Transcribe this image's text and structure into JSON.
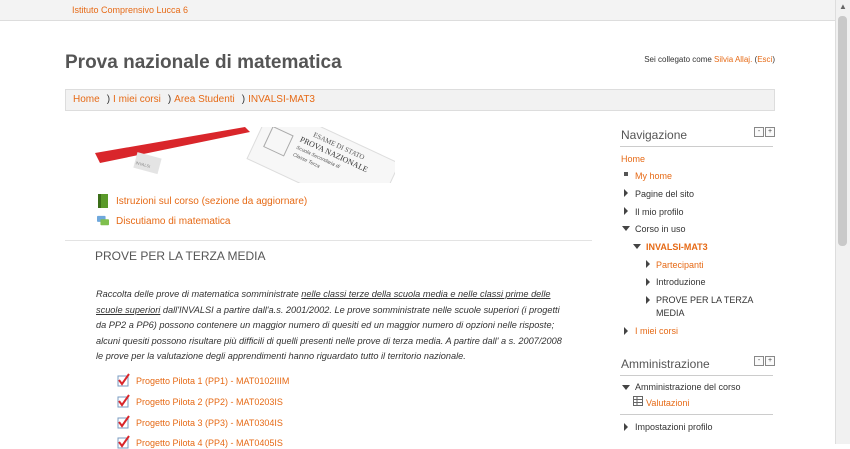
{
  "site_name": "Istituto Comprensivo Lucca 6",
  "page_title": "Prova nazionale di matematica",
  "login": {
    "prefix": "Sei collegato come",
    "user": "Silvia Allaj.",
    "logout_open": "(",
    "logout": "Esci",
    "logout_close": ")"
  },
  "breadcrumb": [
    "Home",
    "I miei corsi",
    "Area Studenti",
    "INVALSI-MAT3"
  ],
  "activities": [
    {
      "label": "Istruzioni sul corso (sezione da aggiornare)",
      "icon": "book-icon"
    },
    {
      "label": "Discutiamo di matematica",
      "icon": "forum-icon"
    }
  ],
  "section": {
    "title": "PROVE PER LA TERZA MEDIA",
    "intro_a": "Raccolta delle prove di matematica somministrate ",
    "intro_u": "nelle classi terze della scuola media e nelle classi prime delle scuole superiori",
    "intro_b": " dall'INVALSI a partire dall'a.s. 2001/2002. Le prove somministrate nelle scuole superiori (i progetti da PP2 a PP6) possono contenere un maggior numero di quesiti ed un maggior numero di opzioni nelle risposte; alcuni quesiti possono risultare più difficili di quelli presenti nelle prove di terza media. A partire dall' a s. 2007/2008 le prove per la valutazione degli apprendimenti hanno riguardato tutto il territorio nazionale."
  },
  "pilots": [
    "Progetto Pilota 1 (PP1) - MAT0102IIIM",
    "Progetto Pilota 2 (PP2) - MAT0203IS",
    "Progetto Pilota 3 (PP3) - MAT0304IS",
    "Progetto Pilota 4 (PP4) - MAT0405IS"
  ],
  "navigation": {
    "title": "Navigazione",
    "home": "Home",
    "my_home": "My home",
    "site_pages": "Pagine del sito",
    "my_profile": "Il mio profilo",
    "current_course": "Corso in uso",
    "course": "INVALSI-MAT3",
    "participants": "Partecipanti",
    "introduction": "Introduzione",
    "section_line1": "PROVE PER LA TERZA",
    "section_line2": "MEDIA",
    "my_courses": "I miei corsi"
  },
  "administration": {
    "title": "Amministrazione",
    "course_admin": "Amministrazione del corso",
    "grades": "Valutazioni",
    "profile_settings": "Impostazioni profilo"
  },
  "block_controls": {
    "hide": "-",
    "move": "+"
  },
  "banner": {
    "stamp_line1": "ESAME DI STATO",
    "stamp_line2": "PROVA NAZIONALE",
    "stamp_line3": "Scuola Secondaria di",
    "stamp_line4": "Classe Terza",
    "logo": "INVALSI"
  },
  "colors": {
    "accent": "#e66a16",
    "bar": "#f3f3f3"
  }
}
